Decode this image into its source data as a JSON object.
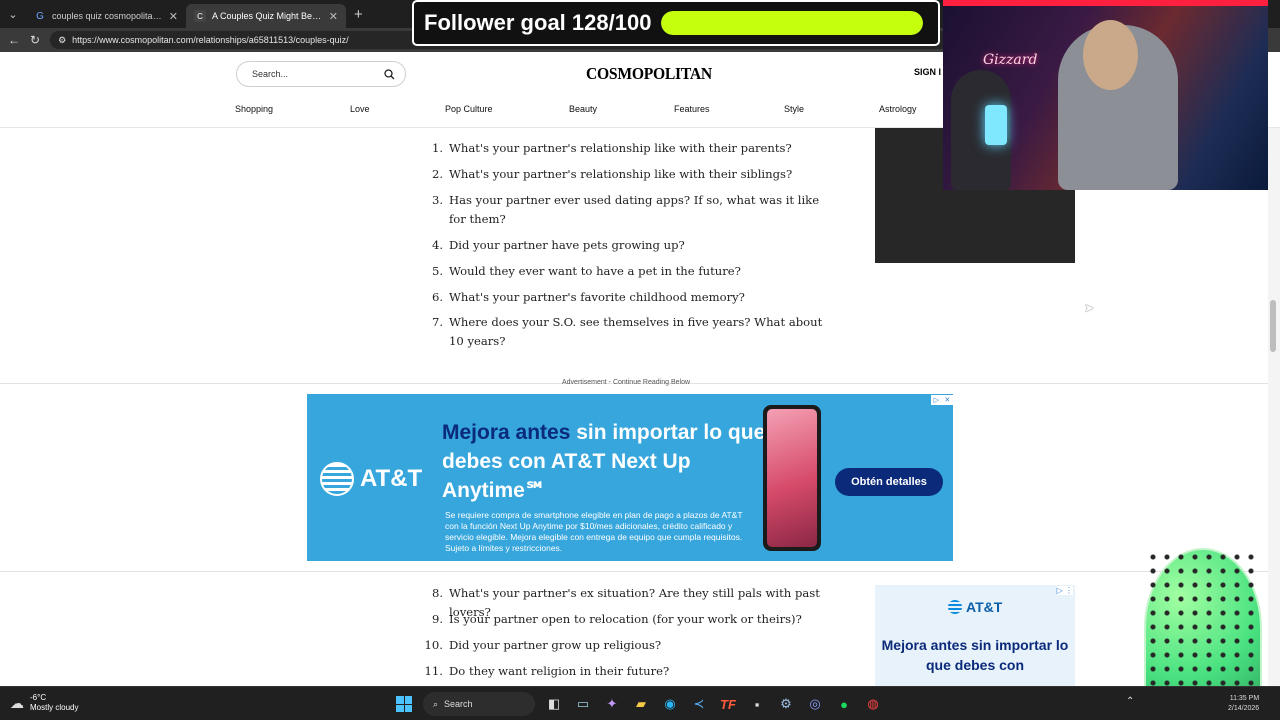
{
  "browser": {
    "tabs": [
      {
        "title": "couples quiz cosmopolitan - Searc",
        "favicon": "search-icon"
      },
      {
        "title": "A Couples Quiz Might Be the Key",
        "favicon": "C",
        "active": true
      }
    ],
    "url": "https://www.cosmopolitan.com/relationships/a65811513/couples-quiz/"
  },
  "site": {
    "search_placeholder": "Search...",
    "logo": "COSMOPOLITAN",
    "signin": "SIGN I",
    "nav": [
      "Shopping",
      "Love",
      "Pop Culture",
      "Beauty",
      "Features",
      "Style",
      "Astrology"
    ]
  },
  "questions_a": [
    {
      "num": "1.",
      "text": "What's your partner's relationship like with their parents?"
    },
    {
      "num": "2.",
      "text": "What's your partner's relationship like with their siblings?"
    },
    {
      "num": "3.",
      "text": "Has your partner ever used dating apps? If so, what was it like for them?"
    },
    {
      "num": "4.",
      "text": "Did your partner have pets growing up?"
    },
    {
      "num": "5.",
      "text": "Would they ever want to have a pet in the future?"
    },
    {
      "num": "6.",
      "text": "What's your partner's favorite childhood memory?"
    },
    {
      "num": "7.",
      "text": "Where does your S.O. see themselves in five years? What about 10 years?"
    }
  ],
  "questions_b": [
    {
      "num": "8.",
      "text": "What's your partner's ex situation? Are they still pals with past lovers?"
    },
    {
      "num": "9.",
      "text": "Is your partner open to relocation (for your work or theirs)?"
    },
    {
      "num": "10.",
      "text": "Did your partner grow up religious?"
    },
    {
      "num": "11.",
      "text": "Do they want religion in their future?"
    }
  ],
  "ad": {
    "label": "Advertisement - Continue Reading Below",
    "brand": "AT&T",
    "headline_highlight": "Mejora antes",
    "headline_rest": " sin importar lo que debes con AT&T Next Up Anytime℠",
    "fine_print": "Se requiere compra de smartphone elegible en plan de pago a plazos de AT&T con la función Next Up Anytime por $10/mes adicionales, crédito calificado y servicio elegible. Mejora elegible con entrega de equipo que cumpla requisitos. Sujeto a límites y restricciones.",
    "cta": "Obtén detalles",
    "brand_color": "#36a6dd",
    "accent_color": "#0b2a7a"
  },
  "side_ad": {
    "brand": "AT&T",
    "text": "Mejora antes sin importar lo que debes con"
  },
  "overlay": {
    "follower_label": "Follower goal 128/100",
    "follower_progress": 1.0,
    "bar_color": "#c6ff0e",
    "neon_sign": "Gizzard"
  },
  "taskbar": {
    "temp": "-6°C",
    "weather": "Mostly cloudy",
    "search": "Search",
    "time": "11:35 PM",
    "date": "2/14/2026",
    "icons": [
      "start-icon",
      "search-icon",
      "widget-icon",
      "file-explorer-icon",
      "copilot-icon",
      "folder-icon",
      "edge-icon",
      "vscode-icon",
      "tf-icon",
      "terminal-icon",
      "steam-icon",
      "discord-icon",
      "spotify-icon",
      "chrome-icon"
    ]
  }
}
